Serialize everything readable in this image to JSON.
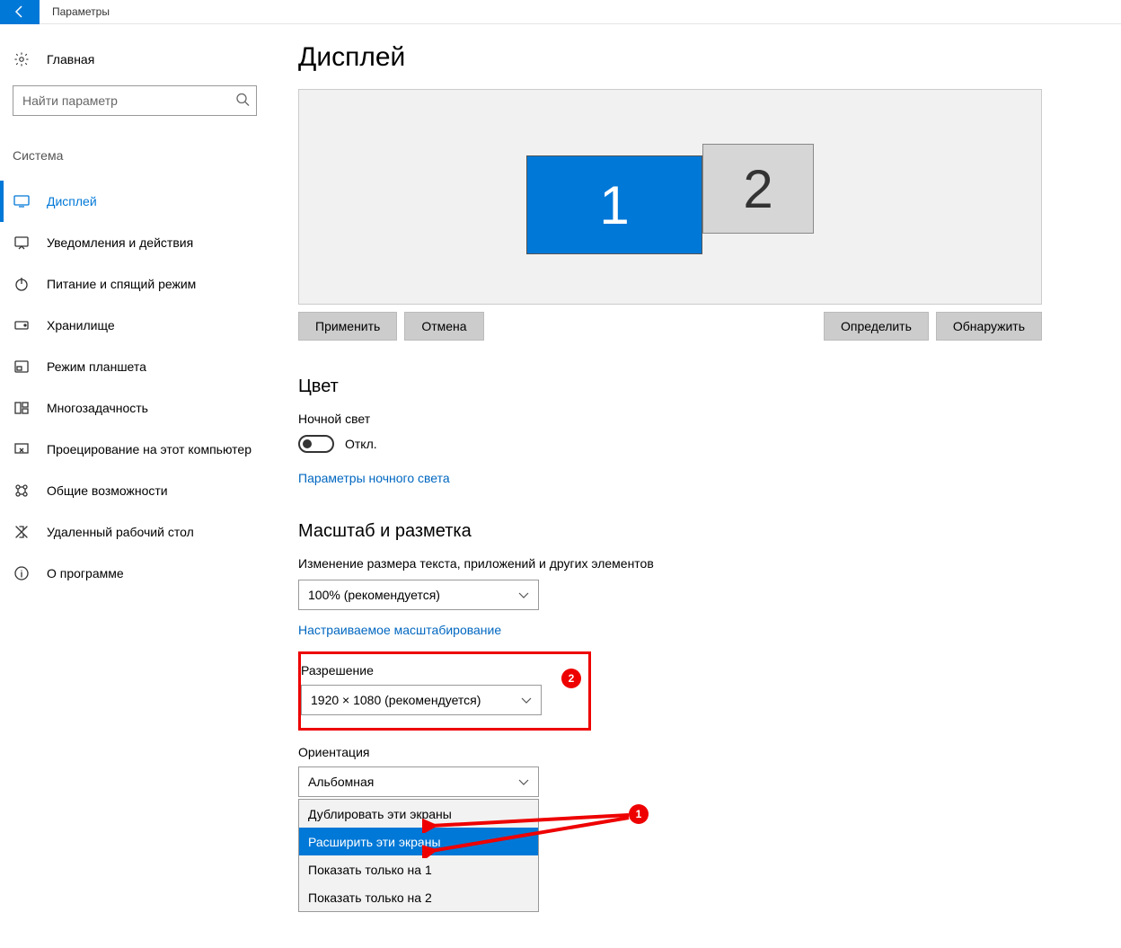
{
  "title": "Параметры",
  "sidebar": {
    "home": "Главная",
    "search_placeholder": "Найти параметр",
    "group": "Система",
    "items": [
      "Дисплей",
      "Уведомления и действия",
      "Питание и спящий режим",
      "Хранилище",
      "Режим планшета",
      "Многозадачность",
      "Проецирование на этот компьютер",
      "Общие возможности",
      "Удаленный рабочий стол",
      "О программе"
    ]
  },
  "page": {
    "heading": "Дисплей",
    "monitor1": "1",
    "monitor2": "2",
    "apply": "Применить",
    "cancel": "Отмена",
    "identify": "Определить",
    "detect": "Обнаружить",
    "color_heading": "Цвет",
    "night_light_label": "Ночной свет",
    "night_light_state": "Откл.",
    "night_light_link": "Параметры ночного света",
    "scale_heading": "Масштаб и разметка",
    "scale_label": "Изменение размера текста, приложений и других элементов",
    "scale_value": "100% (рекомендуется)",
    "scale_link": "Настраиваемое масштабирование",
    "resolution_label": "Разрешение",
    "resolution_value": "1920 × 1080 (рекомендуется)",
    "orientation_label": "Ориентация",
    "orientation_value": "Альбомная",
    "multi_options": [
      "Дублировать эти экраны",
      "Расширить эти экраны",
      "Показать только на 1",
      "Показать только на 2"
    ],
    "annotation1": "1",
    "annotation2": "2"
  }
}
